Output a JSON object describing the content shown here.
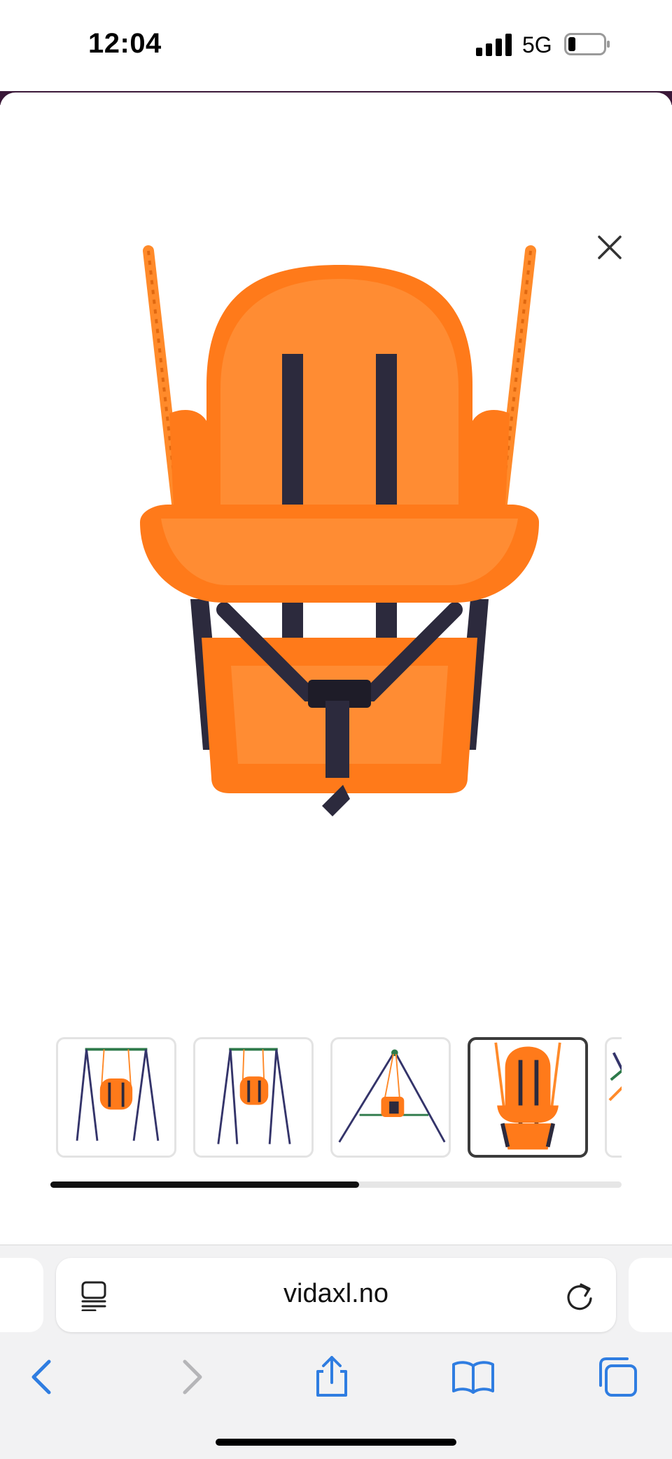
{
  "status_bar": {
    "time": "12:04",
    "network": "5G",
    "icons": [
      "signal-bars-icon",
      "battery-low-icon"
    ]
  },
  "product_gallery": {
    "close_icon": "close-icon",
    "main_image": "orange-baby-swing-seat",
    "thumbnails": [
      {
        "name": "swing-set-front-thumbnail",
        "selected": false
      },
      {
        "name": "swing-set-front-alt-thumbnail",
        "selected": false
      },
      {
        "name": "swing-set-side-thumbnail",
        "selected": false
      },
      {
        "name": "swing-seat-closeup-thumbnail",
        "selected": true
      },
      {
        "name": "swing-detail-thumbnail",
        "selected": false
      }
    ],
    "scroll_progress": 0.54
  },
  "browser": {
    "url": "vidaxl.no",
    "address_icons": [
      "reader-mode-icon",
      "reload-icon"
    ],
    "toolbar": [
      "back-icon",
      "forward-icon",
      "share-icon",
      "bookmarks-icon",
      "tabs-icon"
    ]
  },
  "colors": {
    "accent": "#2f7de1",
    "seat_orange": "#ff7a1a",
    "strap_dark": "#2c2a3d",
    "disabled": "#b5b5b8"
  }
}
